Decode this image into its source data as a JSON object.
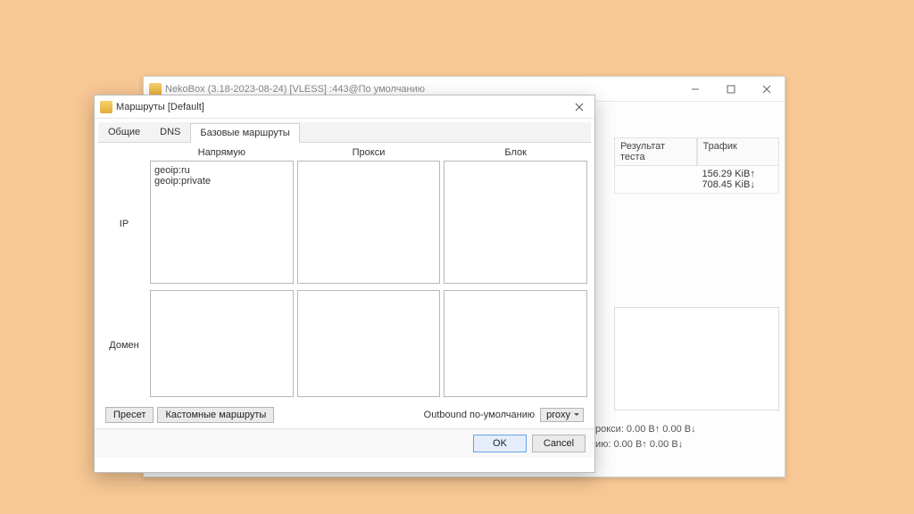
{
  "parent": {
    "title": "NekoBox (3.18-2023-08-24) [VLESS]            :443@По умолчанию",
    "table": {
      "col_test": "Результат теста",
      "col_traffic": "Трафик",
      "row_value": "156.29 KiB↑ 708.45 KiB↓"
    },
    "status_proxy": "рокси: 0.00 B↑ 0.00 B↓",
    "status_default": "ию: 0.00 B↑ 0.00 B↓"
  },
  "dialog": {
    "title": "Маршруты [Default]",
    "tabs": {
      "general": "Общие",
      "dns": "DNS",
      "base_routes": "Базовые маршруты"
    },
    "cols": {
      "direct": "Напрямую",
      "proxy": "Прокси",
      "block": "Блок"
    },
    "rows": {
      "ip": "IP",
      "domain": "Домен"
    },
    "ip_direct_value": "geoip:ru\ngeoip:private",
    "preset_btn": "Пресет",
    "custom_routes_btn": "Кастомные маршруты",
    "outbound_label": "Outbound по-умолчанию",
    "outbound_value": "proxy",
    "ok": "OK",
    "cancel": "Cancel"
  }
}
